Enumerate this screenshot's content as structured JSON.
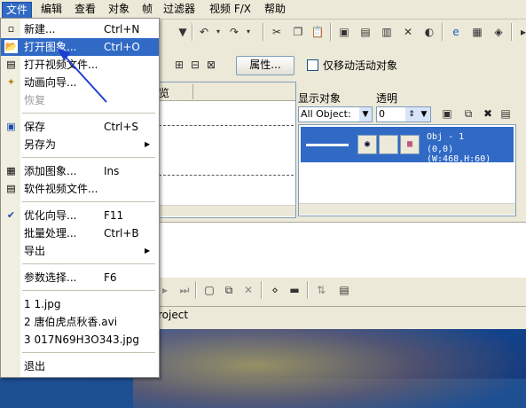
{
  "menubar": [
    "文件",
    "编辑",
    "查看",
    "对象",
    "帧",
    "过滤器",
    "视频 F/X",
    "帮助"
  ],
  "toolbar2": {
    "properties_label": "属性...",
    "move_active_label": "仅移动活动对象"
  },
  "left_tab_partial": "览",
  "right_panel": {
    "display_objects_label": "显示对象",
    "opacity_label": "透明",
    "objects_select": "All Object:",
    "opacity_value": "0",
    "object_name": "Obj - 1",
    "object_info": "(0,0)(W:468,H:60)"
  },
  "status_partial": "roject",
  "file_menu": {
    "items": [
      {
        "label": "新建...",
        "shortcut": "Ctrl+N"
      },
      {
        "label": "打开图象...",
        "shortcut": "Ctrl+O"
      },
      {
        "label": "打开视频文件..."
      },
      {
        "label": "动画向导..."
      },
      {
        "label": "恢复"
      },
      {
        "label": "保存",
        "shortcut": "Ctrl+S"
      },
      {
        "label": "另存为"
      },
      {
        "label": "添加图象...",
        "shortcut": "Ins"
      },
      {
        "label": "软件视频文件..."
      },
      {
        "label": "优化向导...",
        "shortcut": "F11"
      },
      {
        "label": "批量处理...",
        "shortcut": "Ctrl+B"
      },
      {
        "label": "导出"
      },
      {
        "label": "参数选择...",
        "shortcut": "F6"
      },
      {
        "label": "1 1.jpg"
      },
      {
        "label": "2 唐伯虎点秋香.avi"
      },
      {
        "label": "3 017N69H3O343.jpg"
      },
      {
        "label": "退出"
      }
    ]
  }
}
